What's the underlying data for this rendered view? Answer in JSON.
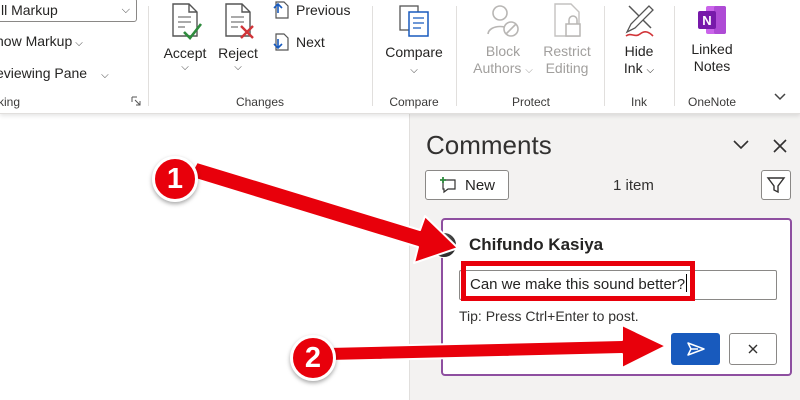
{
  "ribbon": {
    "tracking": {
      "markup_select_value": "ll Markup",
      "show_markup_label": "how Markup",
      "reviewing_pane_label": "eviewing Pane",
      "group_label": "king"
    },
    "changes": {
      "accept_label": "Accept",
      "reject_label": "Reject",
      "previous_label": "Previous",
      "next_label": "Next",
      "group_label": "Changes"
    },
    "compare": {
      "compare_label": "Compare",
      "group_label": "Compare"
    },
    "protect": {
      "block_line1": "Block",
      "block_line2": "Authors",
      "restrict_line1": "Restrict",
      "restrict_line2": "Editing",
      "group_label": "Protect"
    },
    "ink": {
      "hide_line1": "Hide",
      "hide_line2": "Ink",
      "group_label": "Ink"
    },
    "onenote": {
      "linked_line1": "Linked",
      "linked_line2": "Notes",
      "group_label": "OneNote"
    }
  },
  "comments_pane": {
    "title": "Comments",
    "new_label": "New",
    "count_text": "1 item",
    "card": {
      "author": "Chifundo Kasiya",
      "reply_value": "Can we make this sound better?",
      "tip": "Tip: Press Ctrl+Enter to post."
    }
  },
  "annotations": {
    "step1": "1",
    "step2": "2"
  },
  "colors": {
    "accent_blue": "#185abd",
    "card_border": "#8e4fa0",
    "annotation_red": "#e8000b"
  }
}
